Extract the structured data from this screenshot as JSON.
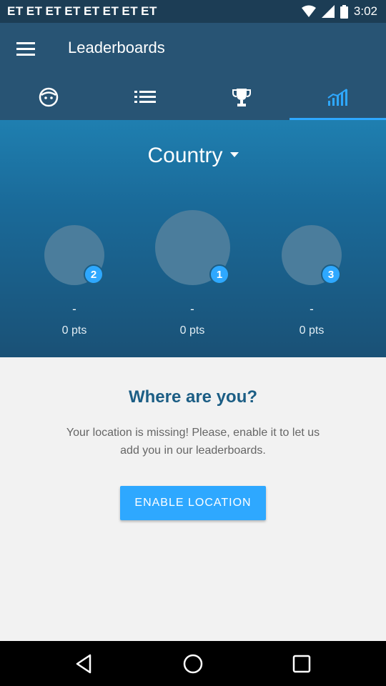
{
  "status_bar": {
    "carriers": [
      "ET",
      "ET",
      "ET",
      "ET",
      "ET",
      "ET",
      "ET",
      "ET"
    ],
    "time": "3:02"
  },
  "app_bar": {
    "title": "Leaderboards",
    "tabs": [
      {
        "name": "profile",
        "icon": "face-icon",
        "active": false
      },
      {
        "name": "list",
        "icon": "list-icon",
        "active": false
      },
      {
        "name": "trophy",
        "icon": "trophy-icon",
        "active": false
      },
      {
        "name": "stats",
        "icon": "signal-chart-icon",
        "active": true
      }
    ]
  },
  "podium": {
    "filter_label": "Country",
    "places": [
      {
        "rank": "2",
        "name": "-",
        "points": "0 pts"
      },
      {
        "rank": "1",
        "name": "-",
        "points": "0 pts"
      },
      {
        "rank": "3",
        "name": "-",
        "points": "0 pts"
      }
    ]
  },
  "location_panel": {
    "title": "Where are you?",
    "message": "Your location is missing! Please, enable it to let us add you in our leaderboards.",
    "button_label": "ENABLE LOCATION"
  },
  "colors": {
    "app_bar": "#285474",
    "accent": "#2ea8ff",
    "title_blue": "#1c5e85"
  }
}
